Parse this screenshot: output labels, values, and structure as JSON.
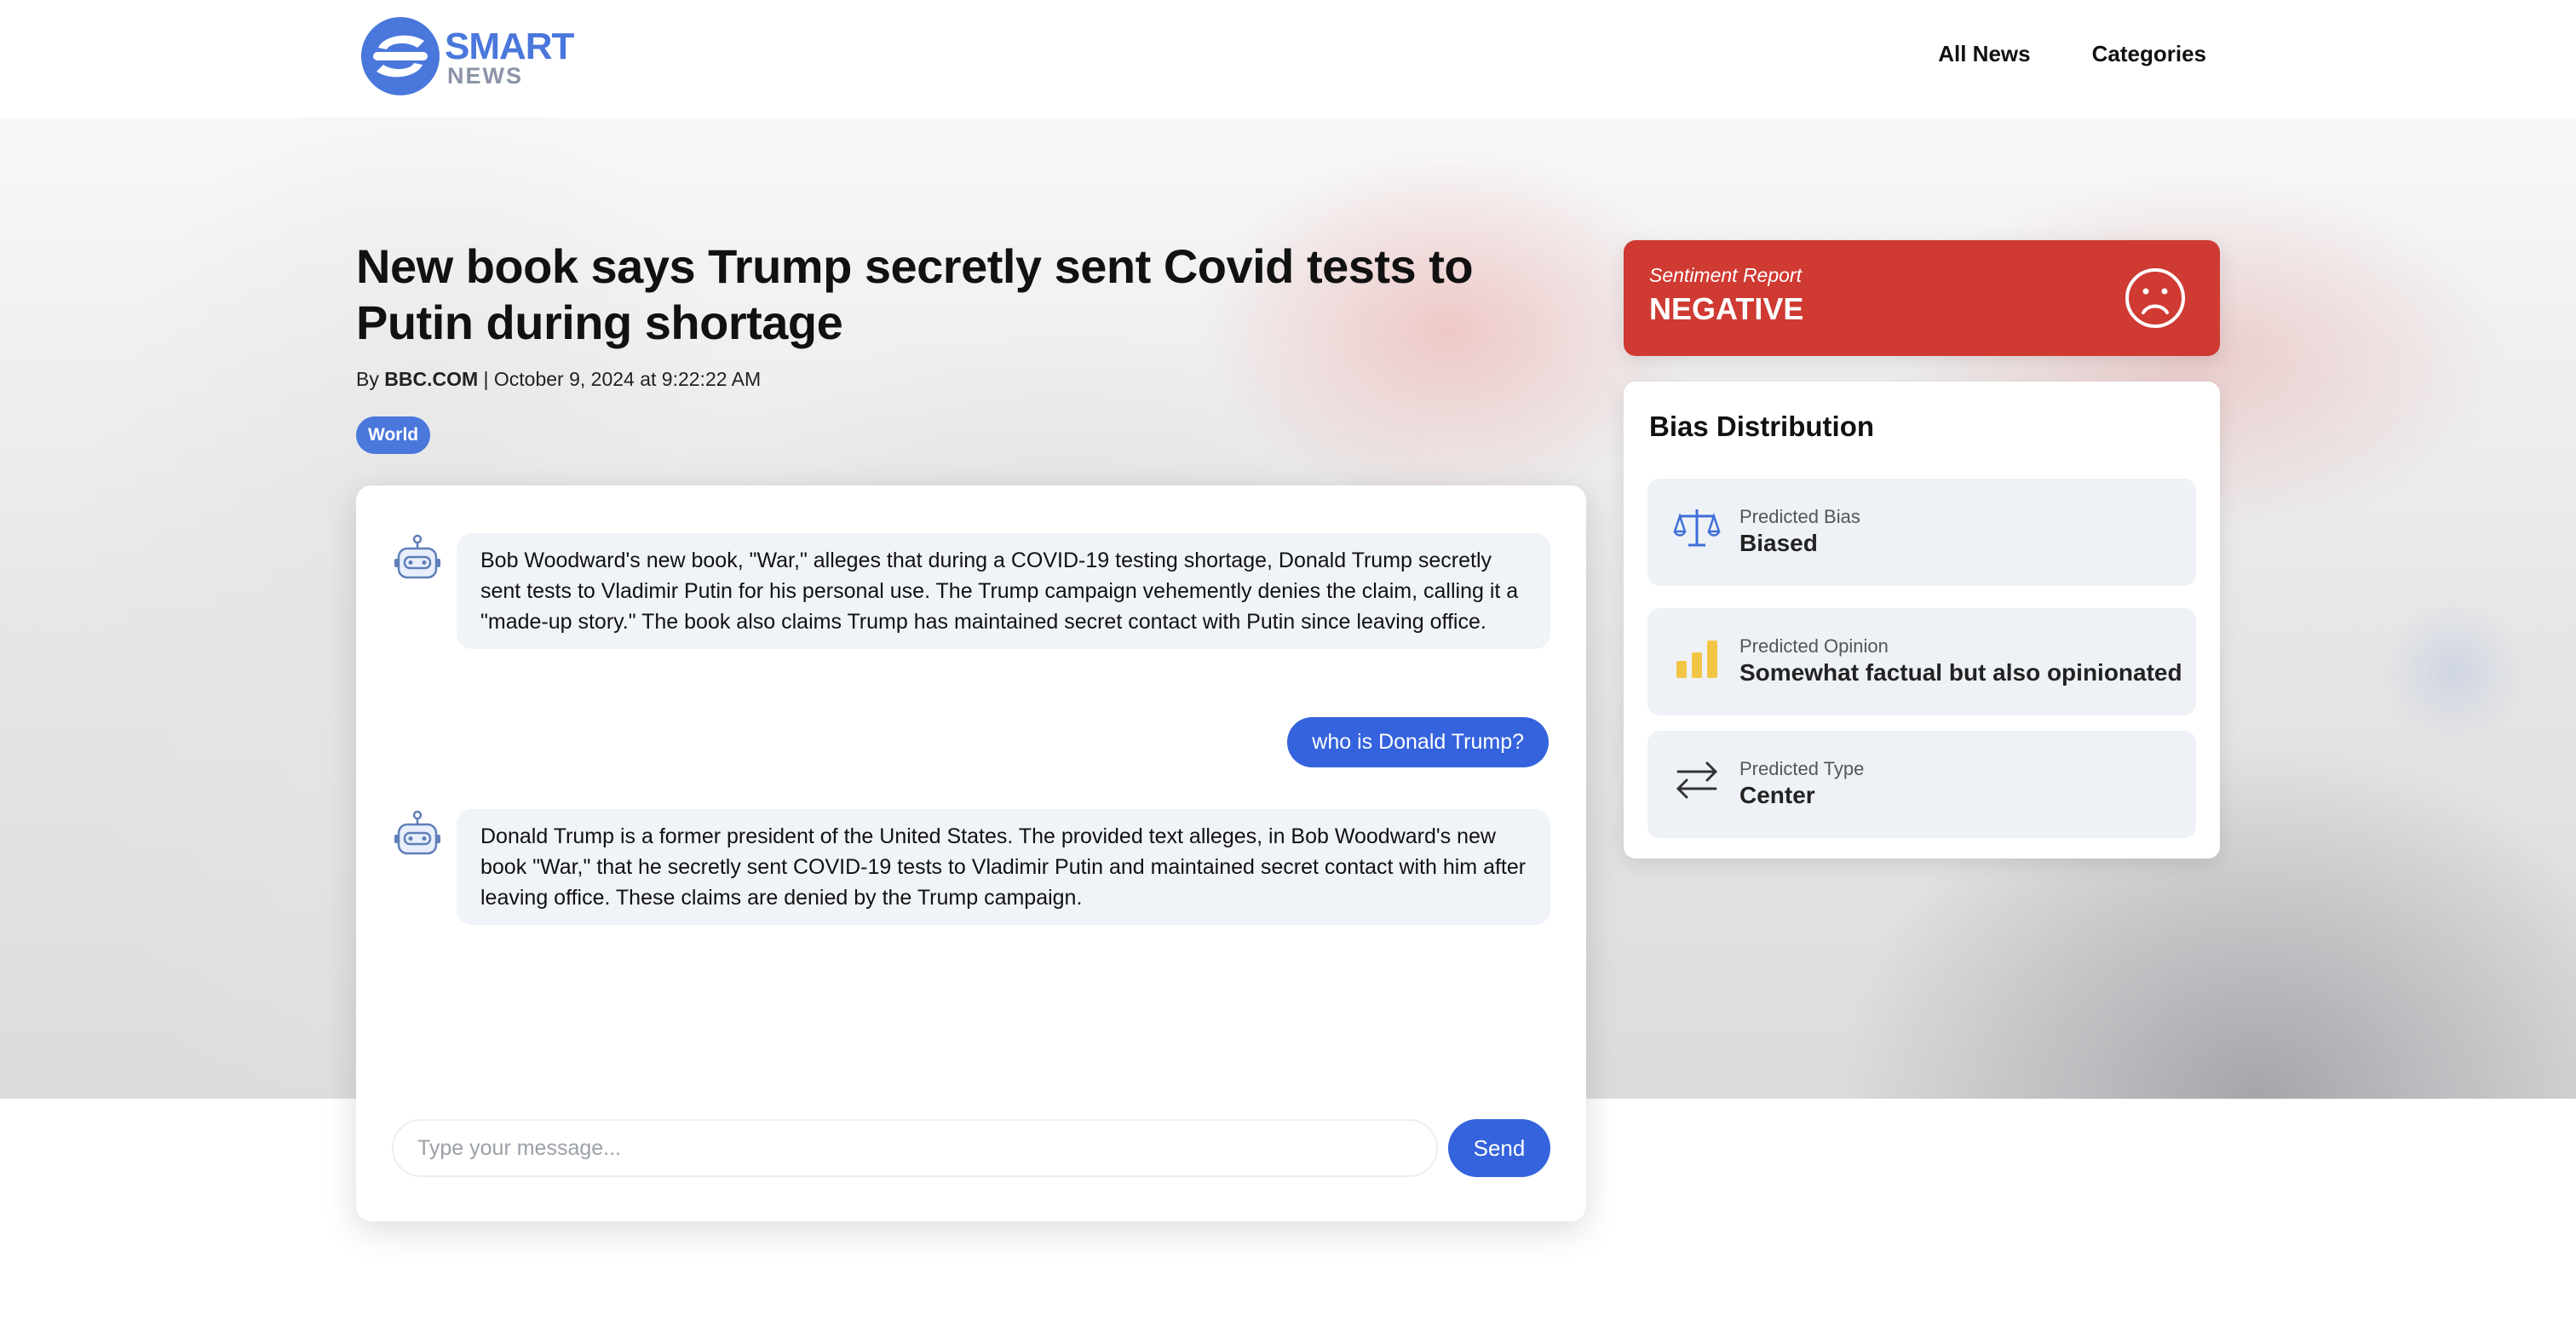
{
  "header": {
    "logo_text_primary": "SMART",
    "logo_text_secondary": "NEWS",
    "nav": [
      "All News",
      "Categories"
    ]
  },
  "article": {
    "title": "New book says Trump secretly sent Covid tests to Putin during shortage",
    "by_prefix": "By",
    "source": "BBC.COM",
    "date": "October 9, 2024 at 9:22:22 AM",
    "category": "World"
  },
  "chat": {
    "messages": [
      {
        "role": "bot",
        "text": "Bob Woodward's new book, \"War,\" alleges that during a COVID-19 testing shortage, Donald Trump secretly sent tests to Vladimir Putin for his personal use. The Trump campaign vehemently denies the claim, calling it a \"made-up story.\" The book also claims Trump has maintained secret contact with Putin since leaving office."
      },
      {
        "role": "user",
        "text": "who is Donald Trump?"
      },
      {
        "role": "bot",
        "text": "Donald Trump is a former president of the United States. The provided text alleges, in Bob Woodward's new book \"War,\" that he secretly sent COVID-19 tests to Vladimir Putin and maintained secret contact with him after leaving office. These claims are denied by the Trump campaign."
      }
    ],
    "input_placeholder": "Type your message...",
    "send_label": "Send"
  },
  "sentiment": {
    "label": "Sentiment Report",
    "value": "NEGATIVE",
    "icon": "sad-face-icon",
    "color": "#cf3a33"
  },
  "bias": {
    "title": "Bias Distribution",
    "items": [
      {
        "label": "Predicted Bias",
        "value": "Biased",
        "icon": "scale-icon"
      },
      {
        "label": "Predicted Opinion",
        "value": "Somewhat factual but also opinionated",
        "icon": "bar-chart-icon"
      },
      {
        "label": "Predicted Type",
        "value": "Center",
        "icon": "swap-arrows-icon"
      }
    ]
  },
  "colors": {
    "accent": "#3563dd",
    "tag": "#4a77dc",
    "negative": "#cf3a33",
    "bubble_bot": "#f0f3f8"
  }
}
